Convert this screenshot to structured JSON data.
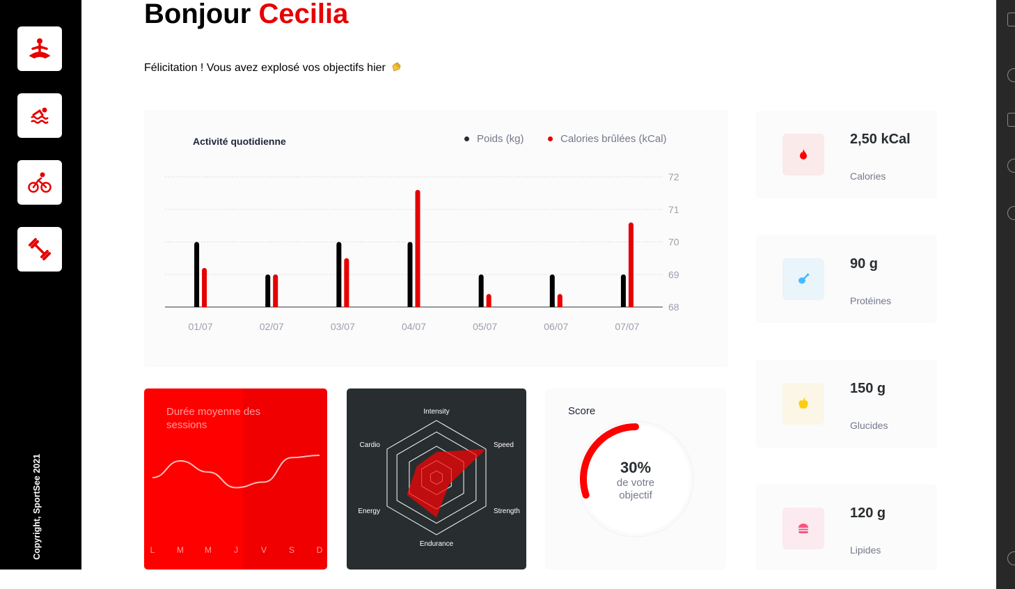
{
  "header": {
    "greeting": "Bonjour",
    "name": "Cecilia",
    "message": "Félicitation ! Vous avez explosé vos objectifs hier"
  },
  "sidebar": {
    "items": [
      {
        "icon": "yoga-icon"
      },
      {
        "icon": "swimming-icon"
      },
      {
        "icon": "cycling-icon"
      },
      {
        "icon": "dumbbell-icon"
      }
    ],
    "copyright": "Copyright, SportSee 2021"
  },
  "colors": {
    "accent": "#e60000",
    "red_card": "#ff0000",
    "dark_card": "#282d30",
    "sidebar": "#000000"
  },
  "daily": {
    "title": "Activité quotidienne",
    "legend_weight": "Poids (kg)",
    "legend_calories": "Calories brûlées (kCal)"
  },
  "sessions": {
    "title": "Durée moyenne des sessions"
  },
  "score": {
    "title": "Score",
    "value": "30%",
    "line1": "de votre",
    "line2": "objectif"
  },
  "key_data": [
    {
      "value": "2,50 kCal",
      "label": "Calories",
      "icon": "fire-icon",
      "bg": "#fbeaea",
      "color": "#ff0000"
    },
    {
      "value": "90 g",
      "label": "Protéines",
      "icon": "chicken-icon",
      "bg": "#e9f4fb",
      "color": "#4ab8ff"
    },
    {
      "value": "150 g",
      "label": "Glucides",
      "icon": "apple-icon",
      "bg": "#fbf6e5",
      "color": "#fdcc0c"
    },
    {
      "value": "120 g",
      "label": "Lipides",
      "icon": "burger-icon",
      "bg": "#fbeaef",
      "color": "#fd5181"
    }
  ],
  "chart_data": [
    {
      "type": "bar",
      "title": "Activité quotidienne",
      "categories": [
        "01/07",
        "02/07",
        "03/07",
        "04/07",
        "05/07",
        "06/07",
        "07/07"
      ],
      "series": [
        {
          "name": "Poids (kg)",
          "values": [
            70,
            69,
            70,
            70,
            69,
            69,
            69
          ],
          "color": "#000000"
        },
        {
          "name": "Calories brûlées (kCal)",
          "values": [
            69.2,
            69,
            69.5,
            71.6,
            68.4,
            68.4,
            70.6
          ],
          "color": "#e60000"
        }
      ],
      "yticks": [
        68,
        69,
        70,
        71,
        72
      ],
      "ylim": [
        68,
        72
      ],
      "legend": "top-right",
      "grid": "horizontal dotted"
    },
    {
      "type": "line",
      "title": "Durée moyenne des sessions",
      "categories": [
        "L",
        "M",
        "M",
        "J",
        "V",
        "S",
        "D"
      ],
      "values": [
        40,
        55,
        45,
        31,
        36,
        58,
        60
      ]
    },
    {
      "type": "radar",
      "categories": [
        "Intensity",
        "Speed",
        "Strength",
        "Endurance",
        "Energy",
        "Cardio"
      ],
      "values": [
        90,
        200,
        50,
        140,
        120,
        80
      ],
      "rmax": 200
    },
    {
      "type": "radial",
      "title": "Score",
      "value": 0.3
    }
  ]
}
